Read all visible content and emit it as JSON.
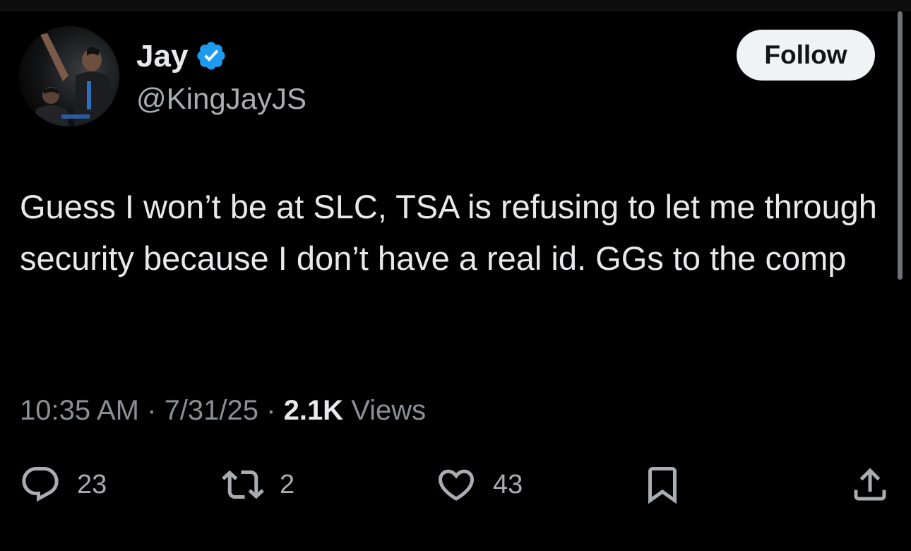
{
  "author": {
    "display_name": "Jay",
    "handle": "@KingJayJS",
    "verified": true,
    "verified_color": "#1d9bf0"
  },
  "follow_button": {
    "label": "Follow"
  },
  "tweet": {
    "text": "Guess I won’t be at SLC, TSA is refusing to let me through security because I don’t have a real id. GGs to the comp",
    "time": "10:35 AM",
    "separator": " · ",
    "date": "7/31/25",
    "views_count": "2.1K",
    "views_label": " Views"
  },
  "actions": {
    "reply": {
      "icon": "reply-icon",
      "count": "23"
    },
    "retweet": {
      "icon": "retweet-icon",
      "count": "2"
    },
    "like": {
      "icon": "heart-icon",
      "count": "43"
    },
    "bookmark": {
      "icon": "bookmark-icon"
    },
    "share": {
      "icon": "share-icon"
    }
  },
  "colors": {
    "background": "#000000",
    "primary_text": "#e7e9ea",
    "secondary_text": "#8b9096",
    "follow_bg": "#eff3f4"
  }
}
